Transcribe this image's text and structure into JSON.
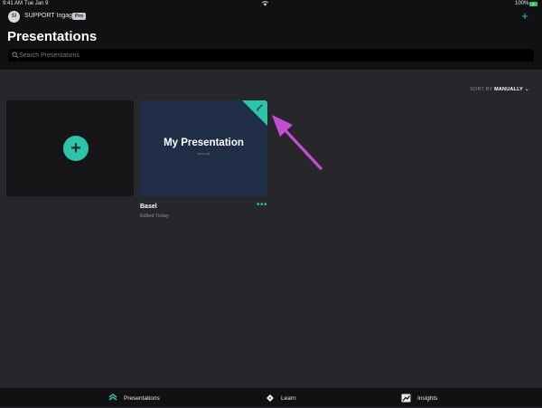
{
  "status_bar": {
    "time": "9:41 AM",
    "date": "Tue Jan 9",
    "battery_percent": "100%"
  },
  "header": {
    "user_initials": "SI",
    "user_name": "SUPPORT Ingage",
    "plan_badge": "Pro",
    "add_icon": "plus-icon",
    "title": "Presentations"
  },
  "search": {
    "placeholder": "Search Presentations",
    "value": ""
  },
  "sort": {
    "label": "SORT BY",
    "value": "MANUALLY"
  },
  "new_presentation": {
    "icon": "plus-icon"
  },
  "presentations": [
    {
      "slide_title": "My Presentation",
      "slide_subtitle": "Tap to edit",
      "name": "Basel",
      "edited": "Edited Today"
    }
  ],
  "tab_bar": {
    "presentations": "Presentations",
    "learn": "Learn",
    "insights": "Insights"
  },
  "colors": {
    "accent": "#2dc4a9",
    "annotation_arrow": "#c24fd3",
    "card_background": "#1f2d47"
  }
}
